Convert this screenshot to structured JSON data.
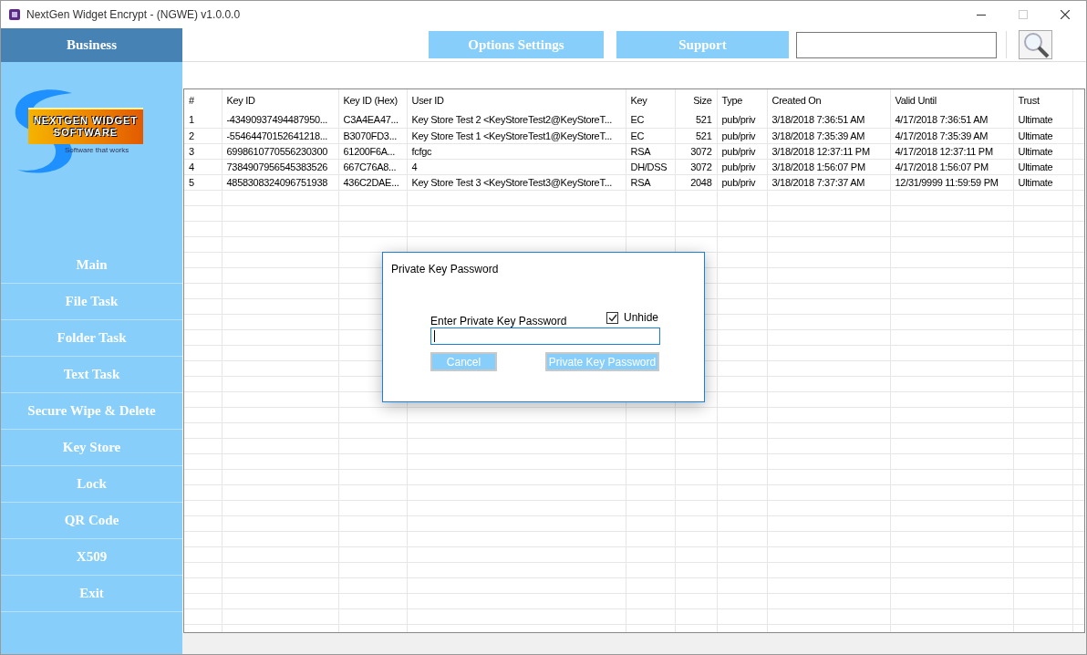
{
  "window": {
    "title": "NextGen Widget Encrypt - (NGWE) v1.0.0.0"
  },
  "sidebar": {
    "header": "Business",
    "logo": {
      "line_1": "NEXTGEN WIDGET",
      "line_2": "SOFTWARE",
      "tagline": "Software that works"
    },
    "items": [
      {
        "label": "Main"
      },
      {
        "label": "File Task"
      },
      {
        "label": "Folder Task"
      },
      {
        "label": "Text Task"
      },
      {
        "label": "Secure Wipe & Delete"
      },
      {
        "label": "Key Store"
      },
      {
        "label": "Lock"
      },
      {
        "label": "QR Code"
      },
      {
        "label": "X509"
      },
      {
        "label": "Exit"
      }
    ]
  },
  "toolbar": {
    "buttons": [
      {
        "label": "Options Settings"
      },
      {
        "label": "Support"
      }
    ]
  },
  "table": {
    "columns": [
      {
        "label": "#"
      },
      {
        "label": "Key ID"
      },
      {
        "label": "Key ID (Hex)"
      },
      {
        "label": "User ID"
      },
      {
        "label": "Key"
      },
      {
        "label": "Size"
      },
      {
        "label": "Type"
      },
      {
        "label": "Created On"
      },
      {
        "label": "Valid Until"
      },
      {
        "label": "Trust"
      }
    ],
    "rows": [
      [
        "1",
        "-43490937494487950...",
        "C3A4EA47...",
        "Key Store Test 2 <KeyStoreTest2@KeyStoreT...",
        "EC",
        "521",
        "pub/priv",
        "3/18/2018 7:36:51 AM",
        "4/17/2018 7:36:51 AM",
        "Ultimate"
      ],
      [
        "2",
        "-55464470152641218...",
        "B3070FD3...",
        "Key Store Test 1 <KeyStoreTest1@KeyStoreT...",
        "EC",
        "521",
        "pub/priv",
        "3/18/2018 7:35:39 AM",
        "4/17/2018 7:35:39 AM",
        "Ultimate"
      ],
      [
        "3",
        "6998610770556230300",
        "61200F6A...",
        "fcfgc",
        "RSA",
        "3072",
        "pub/priv",
        "3/18/2018 12:37:11 PM",
        "4/17/2018 12:37:11 PM",
        "Ultimate"
      ],
      [
        "4",
        "7384907956545383526",
        "667C76A8...",
        "4",
        "DH/DSS",
        "3072",
        "pub/priv",
        "3/18/2018 1:56:07 PM",
        "4/17/2018 1:56:07 PM",
        "Ultimate"
      ],
      [
        "5",
        "4858308324096751938",
        "436C2DAE...",
        "Key Store Test 3 <KeyStoreTest3@KeyStoreT...",
        "RSA",
        "2048",
        "pub/priv",
        "3/18/2018 7:37:37 AM",
        "12/31/9999 11:59:59 PM",
        "Ultimate"
      ]
    ]
  },
  "dialog": {
    "title": "Private Key Password",
    "field_label": "Enter Private Key Password",
    "unhide": {
      "label": "Unhide",
      "checked": true
    },
    "buttons": [
      {
        "label": "Cancel"
      },
      {
        "label": "Private Key Password"
      }
    ]
  }
}
